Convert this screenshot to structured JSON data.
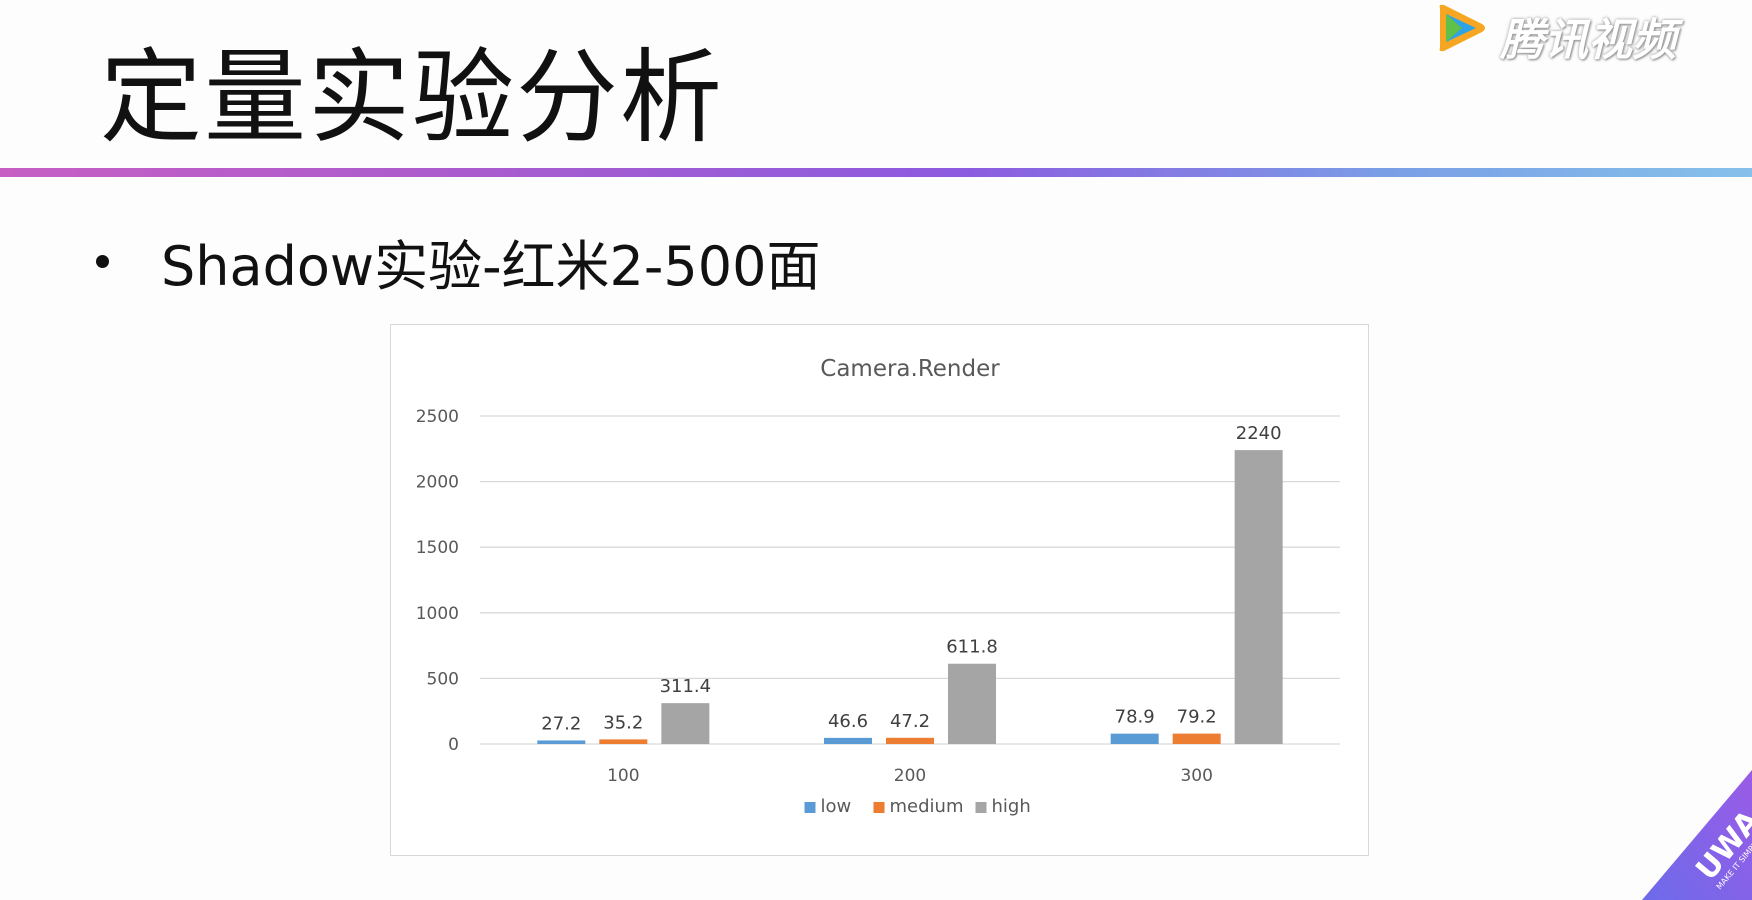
{
  "slide": {
    "title": "定量实验分析",
    "bullet": "Shadow实验-红米2-500面"
  },
  "brand": {
    "logo_text": "腾讯视频",
    "badge_text": "UWA",
    "badge_tagline": "MAKE IT SIMPLE"
  },
  "colors": {
    "low": "#5b9bd5",
    "medium": "#ed7d31",
    "high": "#a5a5a5",
    "title_rule": "#9d5fd6"
  },
  "chart_data": {
    "type": "bar",
    "title": "Camera.Render",
    "categories": [
      "100",
      "200",
      "300"
    ],
    "series": [
      {
        "name": "low",
        "values": [
          27.2,
          46.6,
          78.9
        ],
        "labels": [
          "27.2",
          "46.6",
          "78.9"
        ]
      },
      {
        "name": "medium",
        "values": [
          35.2,
          47.2,
          79.2
        ],
        "labels": [
          "35.2",
          "47.2",
          "79.2"
        ]
      },
      {
        "name": "high",
        "values": [
          311.4,
          611.8,
          2240
        ],
        "labels": [
          "311.4",
          "611.8",
          "2240"
        ]
      }
    ],
    "y_ticks": [
      "0",
      "500",
      "1000",
      "1500",
      "2000",
      "2500"
    ],
    "ylim": [
      0,
      2500
    ],
    "grid": true,
    "legend": "bottom"
  }
}
